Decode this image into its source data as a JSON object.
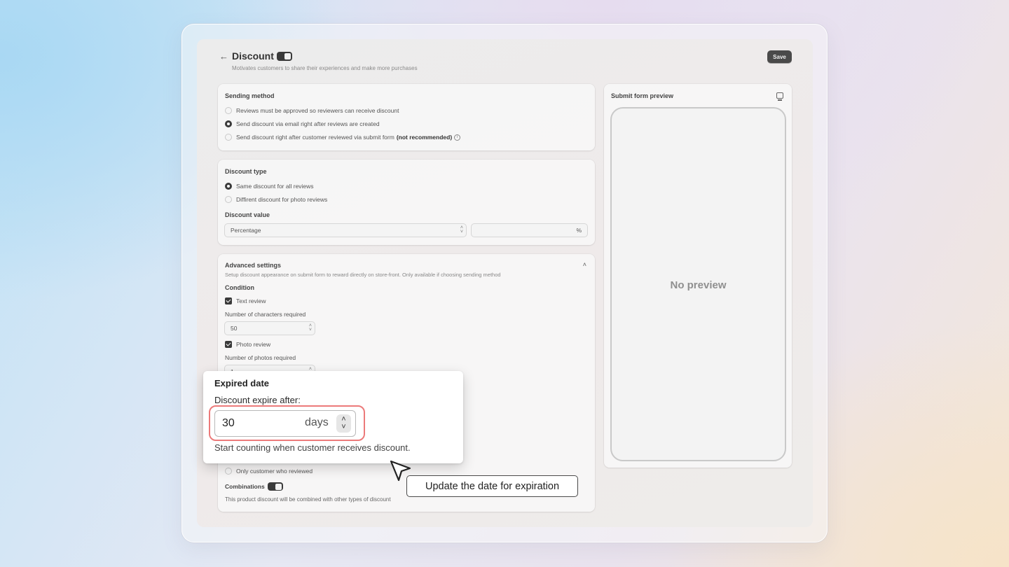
{
  "header": {
    "back_icon": "arrow-left-icon",
    "title": "Discount",
    "subtitle": "Motivates customers to share their experiences and make more purchases",
    "save_label": "Save"
  },
  "sending_method": {
    "title": "Sending method",
    "options": [
      {
        "label": "Reviews must be approved so reviewers can receive discount",
        "selected": false
      },
      {
        "label": "Send discount via email right after reviews are created",
        "selected": true
      },
      {
        "label": "Send discount right after customer reviewed via submit form",
        "bold_suffix": "(not recommended)",
        "selected": false
      }
    ]
  },
  "discount_type": {
    "title": "Discount type",
    "options": [
      {
        "label": "Same discount for all reviews",
        "selected": true
      },
      {
        "label": "Diffirent discount for photo reviews",
        "selected": false
      }
    ],
    "value_title": "Discount value",
    "value_select": "Percentage",
    "value_suffix": "%"
  },
  "advanced": {
    "title": "Advanced settings",
    "description": "Setup discount appearance on submit form to reward directly on store-front. Only available if choosing sending method",
    "condition_title": "Condition",
    "text_review_label": "Text review",
    "chars_label": "Number of characters required",
    "chars_value": "50",
    "photo_review_label": "Photo review",
    "photos_label": "Number of photos required",
    "photos_value": "1",
    "only_customer_label": "Only customer who reviewed",
    "combinations_label": "Combinations",
    "combinations_desc": "This product discount will be combined with other types of discount"
  },
  "preview": {
    "title": "Submit form preview",
    "empty_text": "No preview"
  },
  "popup": {
    "title": "Expired date",
    "label": "Discount expire after:",
    "value": "30",
    "unit": "days",
    "hint": "Start counting when customer receives discount."
  },
  "tooltip": {
    "text": "Update the date for expiration"
  },
  "colors": {
    "highlight": "#ec7a7a",
    "dark": "#3a3a3a"
  }
}
